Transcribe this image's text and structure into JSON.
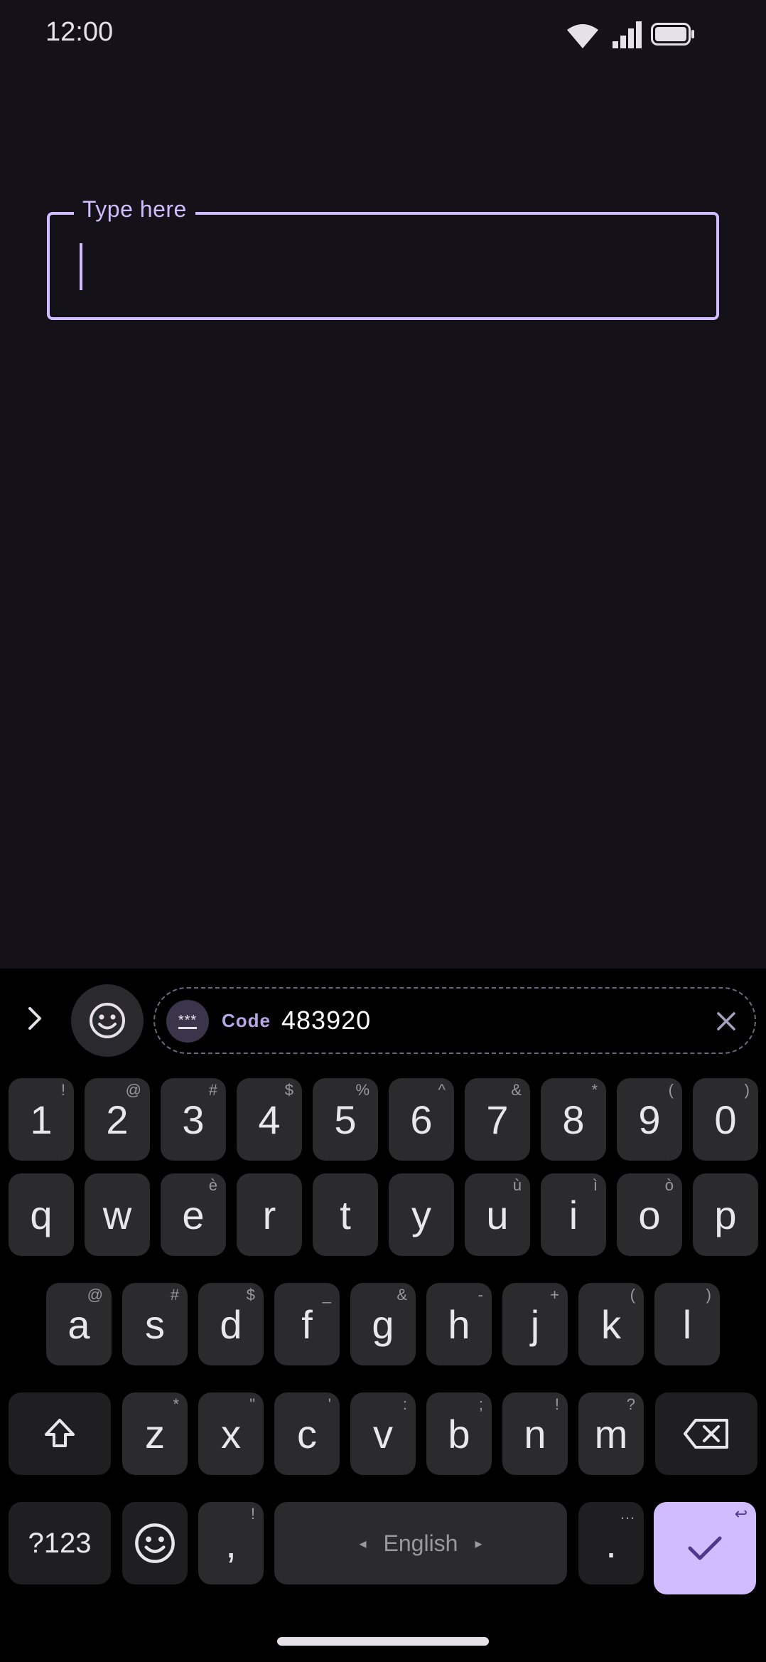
{
  "status_bar": {
    "time": "12:00",
    "icons": [
      "wifi-icon",
      "signal-icon",
      "battery-icon"
    ]
  },
  "text_field": {
    "label": "Type here",
    "value": "",
    "accent_color": "#d0bcff"
  },
  "keyboard": {
    "suggestion_bar": {
      "expand_icon": "chevron-right-icon",
      "emoji_icon": "emoji-icon",
      "code_chip": {
        "icon_text": "***",
        "label": "Code",
        "value": "483920",
        "close_icon": "close-icon"
      }
    },
    "rows": {
      "numbers": [
        {
          "key": "1",
          "hint": "!"
        },
        {
          "key": "2",
          "hint": "@"
        },
        {
          "key": "3",
          "hint": "#"
        },
        {
          "key": "4",
          "hint": "$"
        },
        {
          "key": "5",
          "hint": "%"
        },
        {
          "key": "6",
          "hint": "^"
        },
        {
          "key": "7",
          "hint": "&"
        },
        {
          "key": "8",
          "hint": "*"
        },
        {
          "key": "9",
          "hint": "("
        },
        {
          "key": "0",
          "hint": ")"
        }
      ],
      "top": [
        {
          "key": "q",
          "hint": ""
        },
        {
          "key": "w",
          "hint": ""
        },
        {
          "key": "e",
          "hint": "è"
        },
        {
          "key": "r",
          "hint": ""
        },
        {
          "key": "t",
          "hint": ""
        },
        {
          "key": "y",
          "hint": ""
        },
        {
          "key": "u",
          "hint": "ù"
        },
        {
          "key": "i",
          "hint": "ì"
        },
        {
          "key": "o",
          "hint": "ò"
        },
        {
          "key": "p",
          "hint": ""
        }
      ],
      "middle": [
        {
          "key": "a",
          "hint": "@"
        },
        {
          "key": "s",
          "hint": "#"
        },
        {
          "key": "d",
          "hint": "$"
        },
        {
          "key": "f",
          "hint": "_"
        },
        {
          "key": "g",
          "hint": "&"
        },
        {
          "key": "h",
          "hint": "-"
        },
        {
          "key": "j",
          "hint": "+"
        },
        {
          "key": "k",
          "hint": "("
        },
        {
          "key": "l",
          "hint": ")"
        }
      ],
      "bottom": [
        {
          "key": "z",
          "hint": "*"
        },
        {
          "key": "x",
          "hint": "\""
        },
        {
          "key": "c",
          "hint": "'"
        },
        {
          "key": "v",
          "hint": ":"
        },
        {
          "key": "b",
          "hint": ";"
        },
        {
          "key": "n",
          "hint": "!"
        },
        {
          "key": "m",
          "hint": "?"
        }
      ]
    },
    "function_keys": {
      "shift_icon": "shift-icon",
      "backspace_icon": "backspace-icon",
      "symbols_label": "?123",
      "emoji_icon": "emoji-icon",
      "comma_label": ",",
      "comma_hint": "!",
      "space_label": "English",
      "space_left_arrow": "◂",
      "space_right_arrow": "▸",
      "period_label": ".",
      "period_hint": "…",
      "enter_icon": "check-icon",
      "enter_hint": "↩"
    }
  }
}
